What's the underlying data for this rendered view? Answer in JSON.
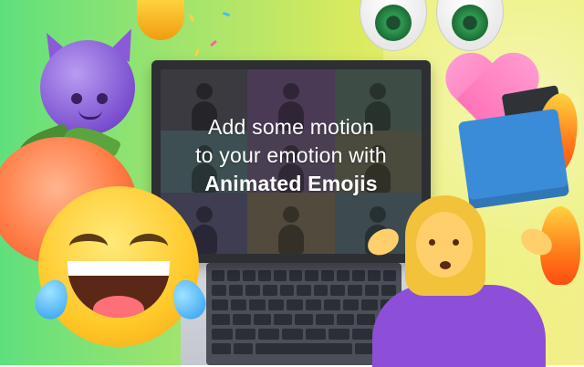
{
  "promo": {
    "headline_line1": "Add some motion",
    "headline_line2": "to your emotion with",
    "headline_line3": "Animated Emojis"
  },
  "colors": {
    "background_start": "#5fe07d",
    "background_end": "#f3ee8c",
    "headline_text": "#ffffff",
    "laptop_frame": "#2d2f33"
  },
  "illustration": {
    "icons": [
      "devil-emoji-icon",
      "peach-emoji-icon",
      "tears-of-joy-emoji-icon",
      "party-popper-icon",
      "eyes-emoji-icon",
      "heart-emoji-icon",
      "dumpster-fire-emoji-icon",
      "shrugging-woman-emoji-icon",
      "laptop-icon"
    ]
  }
}
